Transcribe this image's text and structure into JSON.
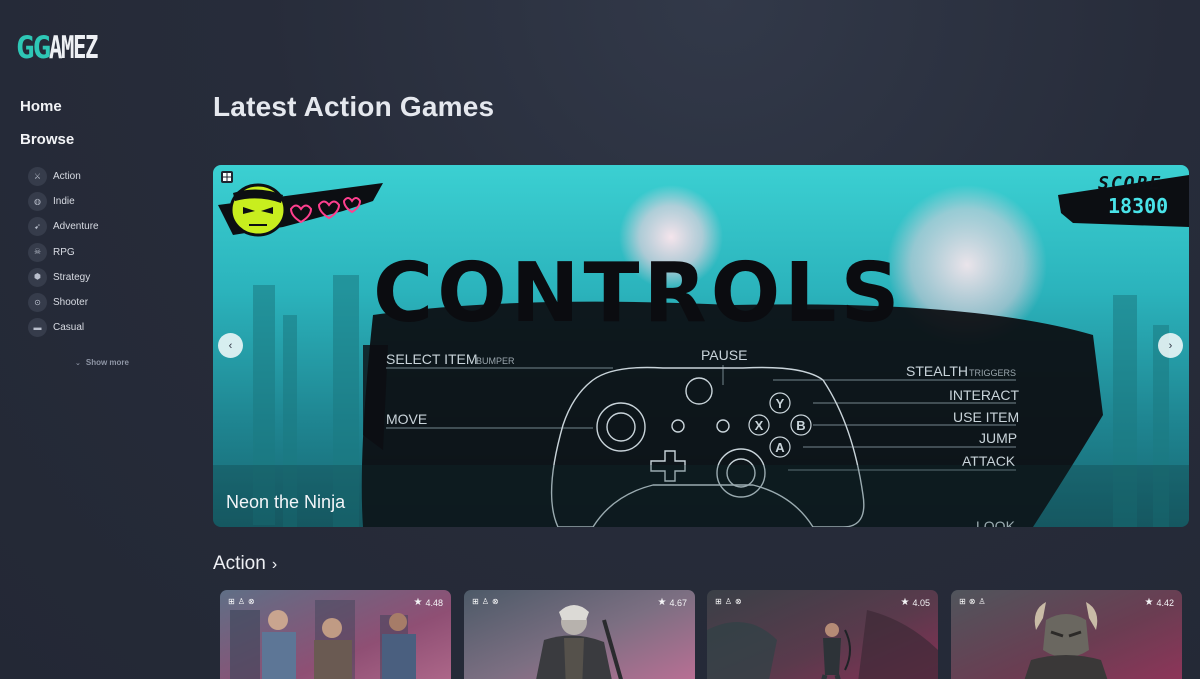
{
  "logo": {
    "part1": "GG",
    "part2": "AMEZ"
  },
  "nav": {
    "home": "Home",
    "browse": "Browse"
  },
  "genres": [
    {
      "label": "Action",
      "icon": "sword-icon",
      "glyph": "⚔"
    },
    {
      "label": "Indie",
      "icon": "fingerprint-icon",
      "glyph": "◍"
    },
    {
      "label": "Adventure",
      "icon": "arrow-icon",
      "glyph": "➹"
    },
    {
      "label": "RPG",
      "icon": "monster-icon",
      "glyph": "☠"
    },
    {
      "label": "Strategy",
      "icon": "dice-icon",
      "glyph": "⬢"
    },
    {
      "label": "Shooter",
      "icon": "crosshair-icon",
      "glyph": "⊙"
    },
    {
      "label": "Casual",
      "icon": "gamepad-icon",
      "glyph": "▬"
    }
  ],
  "show_more": "Show more",
  "page_title": "Latest Action Games",
  "hero": {
    "game_name": "Neon the Ninja",
    "platform_icon": "windows-icon",
    "screenshot_text": {
      "score_label": "SCORE",
      "score_value": "18300",
      "title": "CONTROLS",
      "select_item": "SELECT ITEM",
      "bumper": "BUMPER",
      "pause": "PAUSE",
      "stealth": "STEALTH",
      "triggers": "TRIGGERS",
      "interact": "INTERACT",
      "move": "MOVE",
      "use_item": "USE ITEM",
      "jump": "JUMP",
      "attack": "ATTACK",
      "look": "LOOK",
      "btn_y": "Y",
      "btn_x": "X",
      "btn_b": "B",
      "btn_a": "A"
    }
  },
  "section": {
    "title": "Action",
    "chevron": "›"
  },
  "cards": [
    {
      "rating": "4.48",
      "platforms": [
        "windows-icon",
        "playstation-icon",
        "xbox-icon"
      ],
      "colors": [
        "#6e3b5a",
        "#a06480"
      ]
    },
    {
      "rating": "4.67",
      "platforms": [
        "windows-icon",
        "playstation-icon",
        "xbox-icon"
      ],
      "colors": [
        "#44515f",
        "#b86b8f"
      ]
    },
    {
      "rating": "4.05",
      "platforms": [
        "windows-icon",
        "playstation-icon",
        "xbox-icon"
      ],
      "colors": [
        "#3a4048",
        "#8a2d55"
      ]
    },
    {
      "rating": "4.42",
      "platforms": [
        "windows-icon",
        "xbox-icon",
        "playstation-icon"
      ],
      "colors": [
        "#4c5058",
        "#8d3356"
      ]
    }
  ],
  "colors": {
    "accent": "#2ec7b6",
    "background": "#252a37",
    "hero_cyan": "#3bd0d2"
  }
}
